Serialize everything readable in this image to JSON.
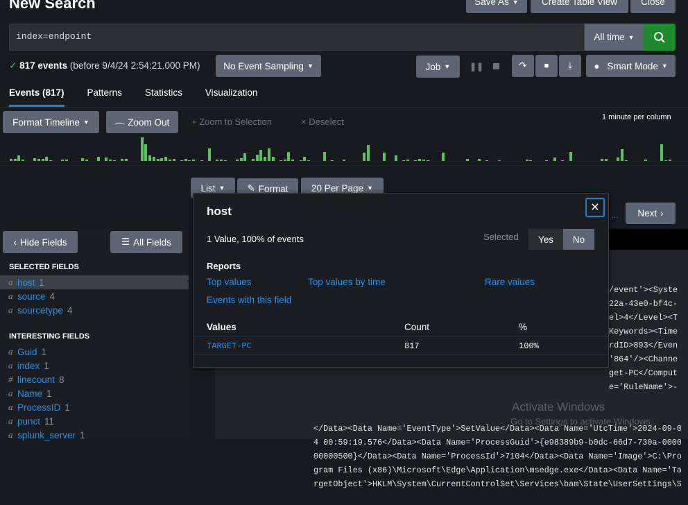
{
  "header": {
    "title": "New Search",
    "save_as": "Save As",
    "create_table_view": "Create Table View",
    "close": "Close"
  },
  "search": {
    "query": "index=endpoint",
    "time_range": "All time",
    "search_icon": "search-icon"
  },
  "status": {
    "count": "817 events",
    "detail": "(before 9/4/24 2:54:21.000 PM)",
    "sampling": "No Event Sampling"
  },
  "job": {
    "label": "Job",
    "mode": "Smart Mode",
    "icons": [
      "pause-icon",
      "stop-icon",
      "share-icon",
      "print-icon",
      "export-icon",
      "bulb-icon"
    ]
  },
  "tabs": [
    "Events (817)",
    "Patterns",
    "Statistics",
    "Visualization"
  ],
  "timeline": {
    "format": "Format Timeline",
    "zoom_out": "Zoom Out",
    "zoom_selection": "Zoom to Selection",
    "deselect": "Deselect",
    "scale": "1 minute per column",
    "color": "#5cc05c"
  },
  "chart_data": {
    "type": "bar",
    "xlabel": "",
    "ylabel": "",
    "bins": [
      [
        0,
        3
      ],
      [
        1,
        3
      ],
      [
        2,
        8
      ],
      [
        3,
        2
      ],
      [
        6,
        4
      ],
      [
        7,
        3
      ],
      [
        8,
        3
      ],
      [
        9,
        6
      ],
      [
        10,
        1
      ],
      [
        13,
        2
      ],
      [
        14,
        2
      ],
      [
        18,
        4
      ],
      [
        19,
        2
      ],
      [
        22,
        6
      ],
      [
        24,
        5
      ],
      [
        25,
        2
      ],
      [
        26,
        1
      ],
      [
        28,
        3
      ],
      [
        29,
        3
      ],
      [
        33,
        34
      ],
      [
        34,
        24
      ],
      [
        35,
        8
      ],
      [
        36,
        6
      ],
      [
        37,
        3
      ],
      [
        38,
        4
      ],
      [
        39,
        6
      ],
      [
        40,
        2
      ],
      [
        41,
        3
      ],
      [
        43,
        1
      ],
      [
        44,
        3
      ],
      [
        45,
        1
      ],
      [
        46,
        2
      ],
      [
        48,
        1
      ],
      [
        50,
        18
      ],
      [
        52,
        2
      ],
      [
        53,
        2
      ],
      [
        54,
        1
      ],
      [
        57,
        2
      ],
      [
        58,
        4
      ],
      [
        59,
        11
      ],
      [
        61,
        3
      ],
      [
        62,
        9
      ],
      [
        63,
        16
      ],
      [
        64,
        6
      ],
      [
        65,
        18
      ],
      [
        66,
        6
      ],
      [
        68,
        1
      ],
      [
        69,
        2
      ],
      [
        70,
        13
      ],
      [
        71,
        2
      ],
      [
        73,
        1
      ],
      [
        74,
        6
      ],
      [
        75,
        1
      ],
      [
        79,
        13
      ],
      [
        81,
        1
      ],
      [
        84,
        2
      ],
      [
        89,
        12
      ],
      [
        90,
        23
      ],
      [
        94,
        12
      ],
      [
        97,
        8
      ],
      [
        99,
        1
      ],
      [
        100,
        2
      ],
      [
        102,
        1
      ],
      [
        103,
        3
      ],
      [
        104,
        2
      ],
      [
        105,
        1
      ],
      [
        109,
        12
      ],
      [
        115,
        3
      ],
      [
        118,
        3
      ],
      [
        120,
        1
      ],
      [
        123,
        1
      ],
      [
        130,
        2
      ],
      [
        131,
        1
      ],
      [
        135,
        1
      ],
      [
        137,
        5
      ],
      [
        139,
        1
      ],
      [
        141,
        13
      ],
      [
        149,
        3
      ],
      [
        150,
        3
      ],
      [
        153,
        5
      ],
      [
        154,
        17
      ],
      [
        155,
        1
      ],
      [
        160,
        2
      ],
      [
        164,
        24
      ],
      [
        165,
        1
      ],
      [
        166,
        2
      ]
    ]
  },
  "results": {
    "list": "List",
    "format": "Format",
    "per_page": "20 Per Page",
    "ellipsis": "...",
    "next": "Next"
  },
  "sidebar": {
    "hide": "Hide Fields",
    "all": "All Fields",
    "selected_title": "SELECTED FIELDS",
    "interesting_title": "INTERESTING FIELDS",
    "selected": [
      {
        "type": "a",
        "name": "host",
        "count": "1"
      },
      {
        "type": "a",
        "name": "source",
        "count": "4"
      },
      {
        "type": "a",
        "name": "sourcetype",
        "count": "4"
      }
    ],
    "interesting": [
      {
        "type": "a",
        "name": "Guid",
        "count": "1"
      },
      {
        "type": "a",
        "name": "index",
        "count": "1"
      },
      {
        "type": "#",
        "name": "linecount",
        "count": "8"
      },
      {
        "type": "a",
        "name": "Name",
        "count": "1"
      },
      {
        "type": "a",
        "name": "ProcessID",
        "count": "1"
      },
      {
        "type": "a",
        "name": "punct",
        "count": "11"
      },
      {
        "type": "a",
        "name": "splunk_server",
        "count": "1"
      }
    ]
  },
  "popup": {
    "title": "host",
    "summary": "1 Value, 100% of events",
    "selected_label": "Selected",
    "yes": "Yes",
    "no": "No",
    "reports_title": "Reports",
    "top_values": "Top values",
    "top_by_time": "Top values by time",
    "rare": "Rare values",
    "events_with": "Events with this field",
    "col_values": "Values",
    "col_count": "Count",
    "col_pct": "%",
    "rows": [
      {
        "value": "TARGET-PC",
        "count": "817",
        "pct": "100%"
      }
    ]
  },
  "event_lines_partial": [
    "/event'><Syste",
    "22a-43e0-bf4c-",
    "el>4</Level><T",
    "Keywords><Time",
    "rdID>893</Even",
    "'864'/><Channe",
    "get-PC</Comput",
    "e='RuleName'>-"
  ],
  "event_lines": [
    "</Data><Data Name='EventType'>SetValue</Data><Data Name='UtcTime'>2024-09-0",
    "4 00:59:19.576</Data><Data Name='ProcessGuid'>{e98389b9-b0dc-66d7-730a-0000",
    "00000500}</Data><Data Name='ProcessId'>7104</Data><Data Name='Image'>C:\\Pro",
    "gram Files (x86)\\Microsoft\\Edge\\Application\\msedge.exe</Data><Data Name='Ta",
    "rgetObject'>HKLM\\System\\CurrentControlSet\\Services\\bam\\State\\UserSettings\\S"
  ],
  "watermark": {
    "title": "Activate Windows",
    "sub": "Go to Settings to activate Windows."
  }
}
